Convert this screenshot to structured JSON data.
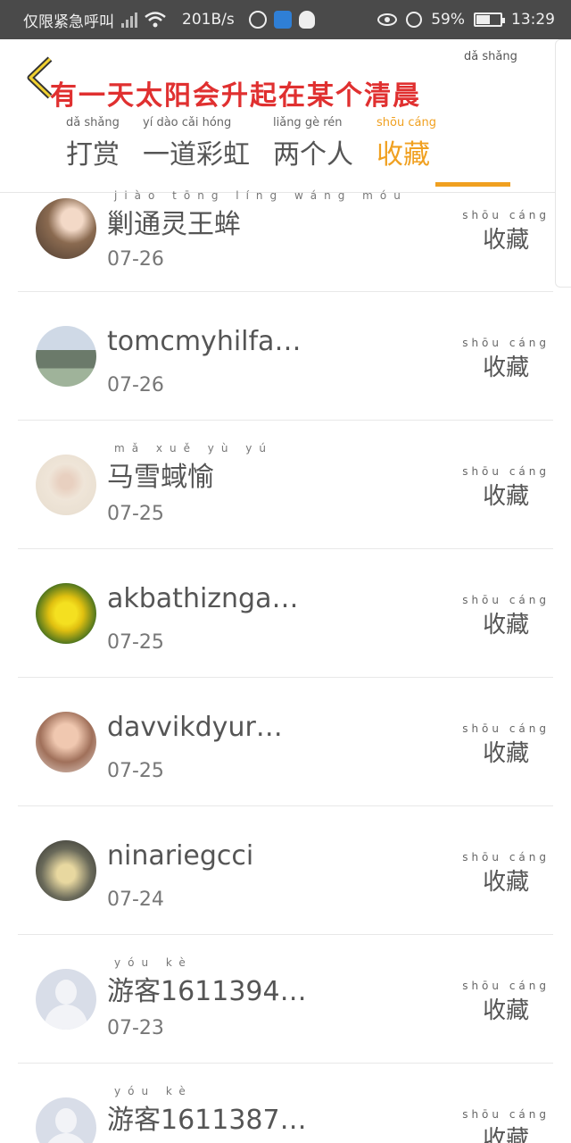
{
  "status_bar": {
    "left_text": "仅限紧急呼叫",
    "speed": "201B/s",
    "battery": "59%",
    "time": "13:29",
    "battery_level": 0.59
  },
  "header": {
    "title": "有一天太阳会升起在某个清晨",
    "title_ruby": "dǎ shǎng",
    "tabs": [
      {
        "pinyin": "dǎ shǎng",
        "label": "打赏"
      },
      {
        "pinyin": "yí dào cǎi hóng",
        "label": "一道彩虹"
      },
      {
        "pinyin": "liǎng gè rén",
        "label": "两个人"
      },
      {
        "pinyin": "shōu cáng",
        "label": "收藏"
      }
    ],
    "active_tab": 3
  },
  "list": {
    "fav_pinyin": "shōu cáng",
    "fav_label": "收藏",
    "items": [
      {
        "pinyin": "jiào tōng líng wáng móu",
        "name": "剿通灵王蛑",
        "date": "07-26"
      },
      {
        "pinyin": "",
        "name": "tomcmyhilfa…",
        "date": "07-26"
      },
      {
        "pinyin": "mǎ xuě yù yú",
        "name": "马雪蜮愉",
        "date": "07-25"
      },
      {
        "pinyin": "",
        "name": "akbathiznga…",
        "date": "07-25"
      },
      {
        "pinyin": "",
        "name": "davvikdyur…",
        "date": "07-25"
      },
      {
        "pinyin": "",
        "name": "ninariegcci",
        "date": "07-24"
      },
      {
        "pinyin": "yóu kè",
        "name": "游客1611394…",
        "date": "07-23"
      },
      {
        "pinyin": "yóu kè",
        "name": "游客1611387…",
        "date": ""
      }
    ]
  },
  "colors": {
    "accent": "#f0a020",
    "title_red": "#e03030",
    "status_bg": "#4a4a4a"
  }
}
